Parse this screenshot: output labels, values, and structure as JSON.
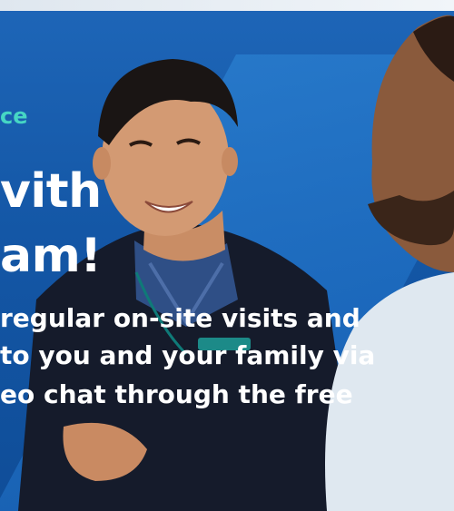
{
  "flyer": {
    "eyebrow": "ce",
    "headline_line1": "vith",
    "headline_line2": "am!",
    "body_line1": "regular on-site visits and",
    "body_line2": "to you and your family via",
    "body_line3": "eo chat through the free"
  },
  "colors": {
    "background_blue": "#1e66b8",
    "accent_teal": "#46d6c4",
    "text_white": "#ffffff"
  }
}
